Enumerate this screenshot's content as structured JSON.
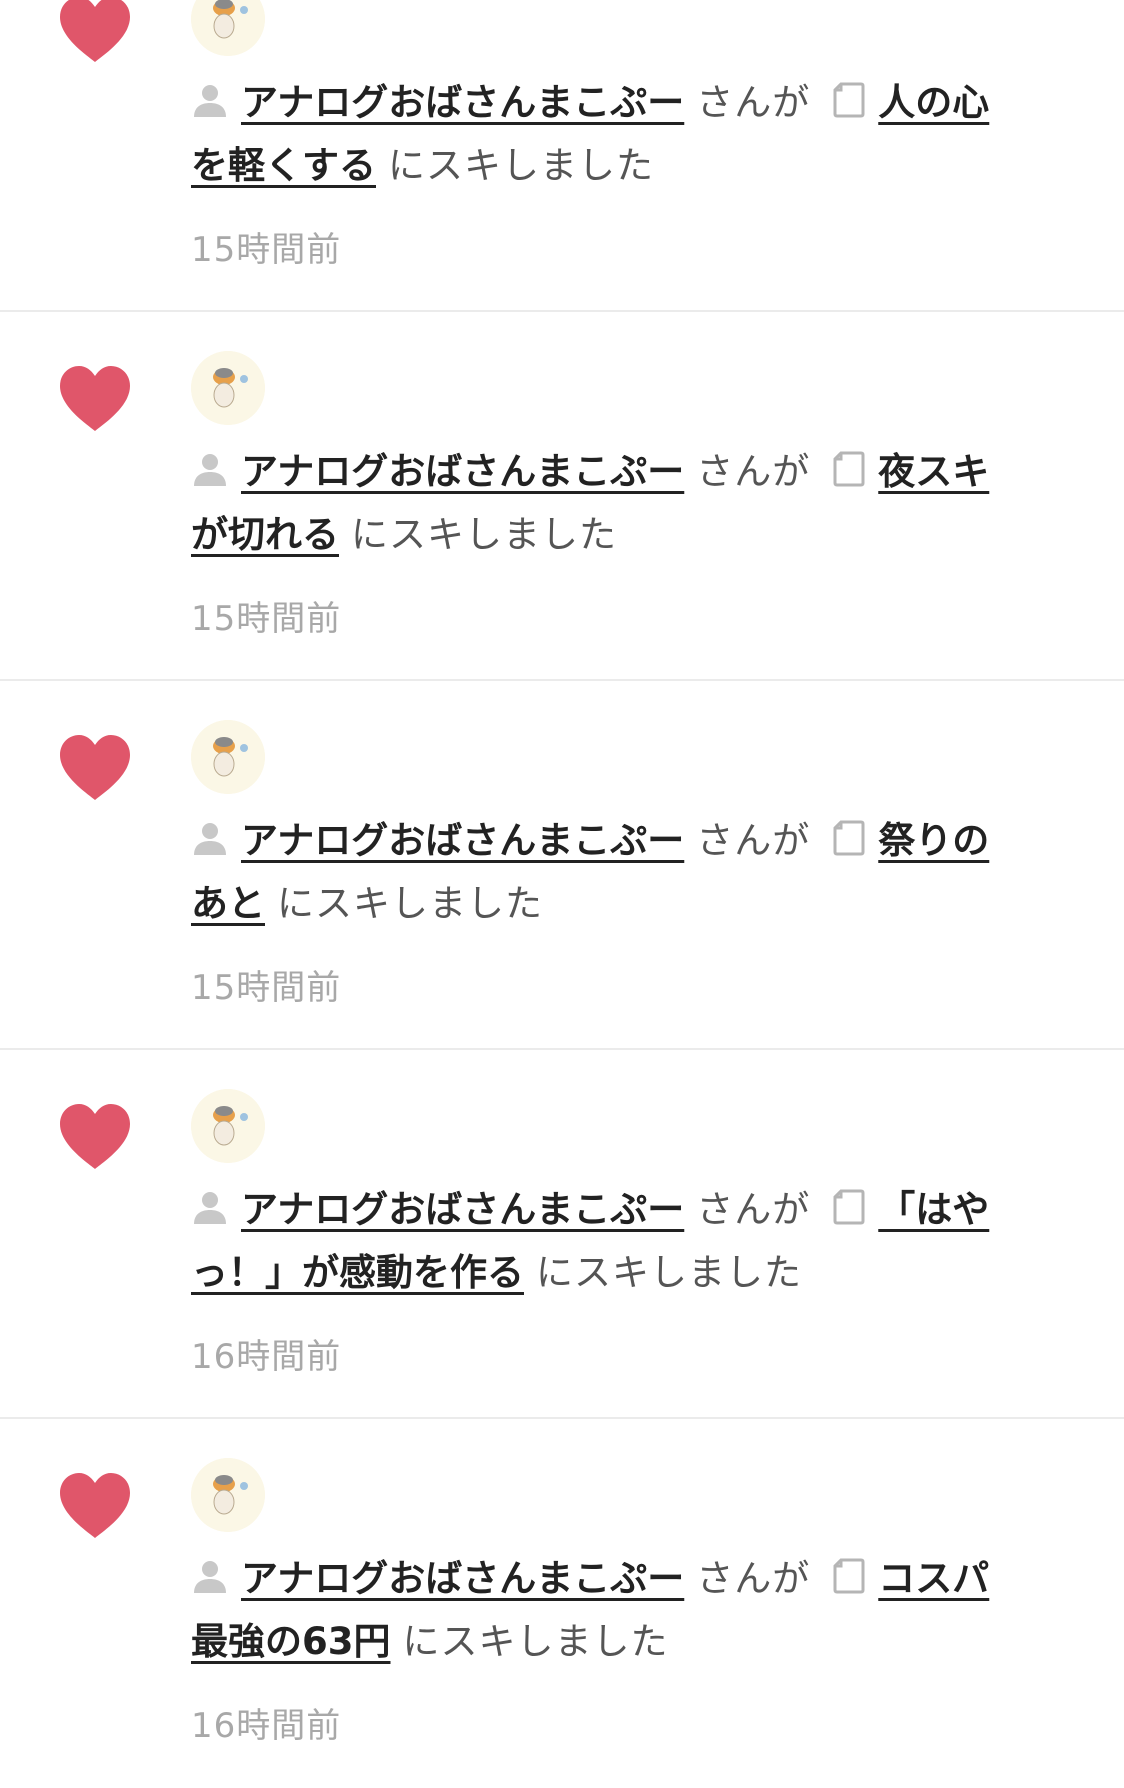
{
  "notifications": [
    {
      "user_name": "アナログおばさんまこぷー",
      "action_prefix": "さんが",
      "article_title": "人の心を軽くする",
      "action_suffix": "にスキしました",
      "time": "15時間前"
    },
    {
      "user_name": "アナログおばさんまこぷー",
      "action_prefix": "さんが",
      "article_title": "夜スキが切れる",
      "action_suffix": "にスキしました",
      "time": "15時間前"
    },
    {
      "user_name": "アナログおばさんまこぷー",
      "action_prefix": "さんが",
      "article_title": "祭りのあと",
      "action_suffix": "にスキしました",
      "time": "15時間前"
    },
    {
      "user_name": "アナログおばさんまこぷー",
      "action_prefix": "さんが",
      "article_title": "「はやっ！」が感動を作る",
      "action_suffix": "にスキしました",
      "time": "16時間前"
    },
    {
      "user_name": "アナログおばさんまこぷー",
      "action_prefix": "さんが",
      "article_title": "コスパ最強の63円",
      "action_suffix": "にスキしました",
      "time": "16時間前"
    }
  ],
  "icons": {
    "like": "heart-icon",
    "user": "user-icon",
    "article": "note-icon"
  },
  "colors": {
    "heart": "#e0566a",
    "timestamp": "#a8a8a8",
    "link": "#222222",
    "divider": "#ebebeb"
  }
}
